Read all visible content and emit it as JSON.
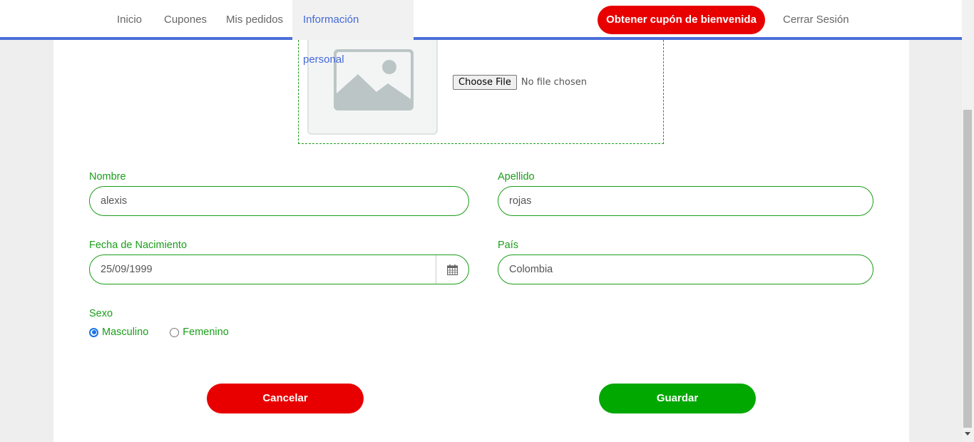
{
  "nav": {
    "items": [
      {
        "label": "Inicio"
      },
      {
        "label": "Cupones"
      },
      {
        "label": "Mis pedidos"
      },
      {
        "label": "Información personal"
      }
    ],
    "welcome_button": "Obtener cupón de bienvenida",
    "logout": "Cerrar Sesión"
  },
  "upload": {
    "button_label": "Choose File",
    "status": "No file chosen"
  },
  "form": {
    "nombre": {
      "label": "Nombre",
      "value": "alexis"
    },
    "apellido": {
      "label": "Apellido",
      "value": "rojas"
    },
    "fecha": {
      "label": "Fecha de Nacimiento",
      "value": "25/09/1999"
    },
    "pais": {
      "label": "País",
      "value": "Colombia"
    },
    "sexo": {
      "label": "Sexo",
      "options": [
        {
          "label": "Masculino",
          "checked": true
        },
        {
          "label": "Femenino",
          "checked": false
        }
      ]
    }
  },
  "actions": {
    "cancel": "Cancelar",
    "save": "Guardar"
  },
  "colors": {
    "accent_blue": "#4a6fd8",
    "brand_red": "#e80000",
    "form_green": "#1a9d1a",
    "save_green": "#00a800"
  }
}
